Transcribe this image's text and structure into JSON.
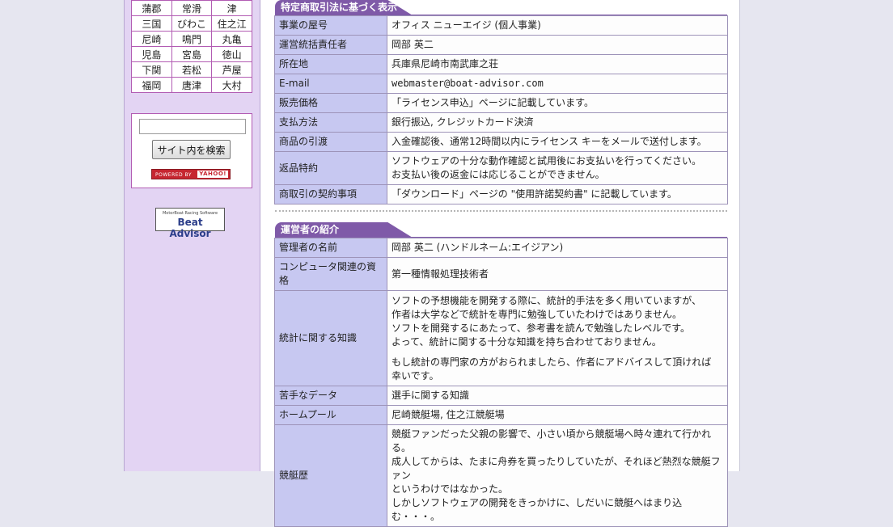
{
  "venues": [
    [
      "蒲郡",
      "常滑",
      "津"
    ],
    [
      "三国",
      "びわこ",
      "住之江"
    ],
    [
      "尼崎",
      "鳴門",
      "丸亀"
    ],
    [
      "児島",
      "宮島",
      "徳山"
    ],
    [
      "下関",
      "若松",
      "芦屋"
    ],
    [
      "福岡",
      "唐津",
      "大村"
    ]
  ],
  "search": {
    "placeholder": "",
    "button_label": "サイト内を検索",
    "powered_by": "POWERED BY",
    "yahoo": "YAHOO!"
  },
  "logo": {
    "subtitle": "MotorBoat Racing Software",
    "name": "Beat Advisor"
  },
  "section1": {
    "title": "特定商取引法に基づく表示",
    "rows": [
      {
        "label": "事業の屋号",
        "value": "オフィス ニューエイジ (個人事業)"
      },
      {
        "label": "運営統括責任者",
        "value": "岡部 英二"
      },
      {
        "label": "所在地",
        "value": "兵庫県尼崎市南武庫之荘"
      },
      {
        "label": "E-mail",
        "value": "webmaster@boat-advisor.com"
      },
      {
        "label": "販売価格",
        "value": "「ライセンス申込」ページに記載しています。"
      },
      {
        "label": "支払方法",
        "value": "銀行振込, クレジットカード決済"
      },
      {
        "label": "商品の引渡",
        "value": "入金確認後、通常12時間以内にライセンス キーをメールで送付します。"
      },
      {
        "label": "返品特約",
        "value": [
          "ソフトウェアの十分な動作確認と試用後にお支払いを行ってください。",
          "お支払い後の返金には応じることができません。"
        ]
      },
      {
        "label": "商取引の契約事項",
        "value": "「ダウンロード」ページの \"使用許諾契約書\" に記載しています。"
      }
    ]
  },
  "section2": {
    "title": "運営者の紹介",
    "rows": [
      {
        "label": "管理者の名前",
        "value": "岡部 英二 (ハンドルネーム:エイジアン)"
      },
      {
        "label": "コンピュータ関連の資格",
        "value": "第一種情報処理技術者"
      },
      {
        "label": "統計に関する知識",
        "paras": [
          [
            "ソフトの予想機能を開発する際に、統計的手法を多く用いていますが、",
            "作者は大学などで統計を専門に勉強していたわけではありません。",
            "ソフトを開発するにあたって、参考書を読んで勉強したレベルです。",
            "よって、統計に関する十分な知識を持ち合わせておりません。"
          ],
          [
            "もし統計の専門家の方がおられましたら、作者にアドバイスして頂ければ",
            "幸いです。"
          ]
        ]
      },
      {
        "label": "苦手なデータ",
        "value": "選手に関する知識"
      },
      {
        "label": "ホームプール",
        "value": "尼崎競艇場, 住之江競艇場"
      },
      {
        "label": "競艇歴",
        "value": [
          "競艇ファンだった父親の影響で、小さい頃から競艇場へ時々連れて行かれる。",
          "成人してからは、たまに舟券を買ったりしていたが、それほど熱烈な競艇ファン",
          "というわけではなかった。",
          "しかしソフトウェアの開発をきっかけに、しだいに競艇へはまり込む・・・。"
        ]
      }
    ]
  }
}
